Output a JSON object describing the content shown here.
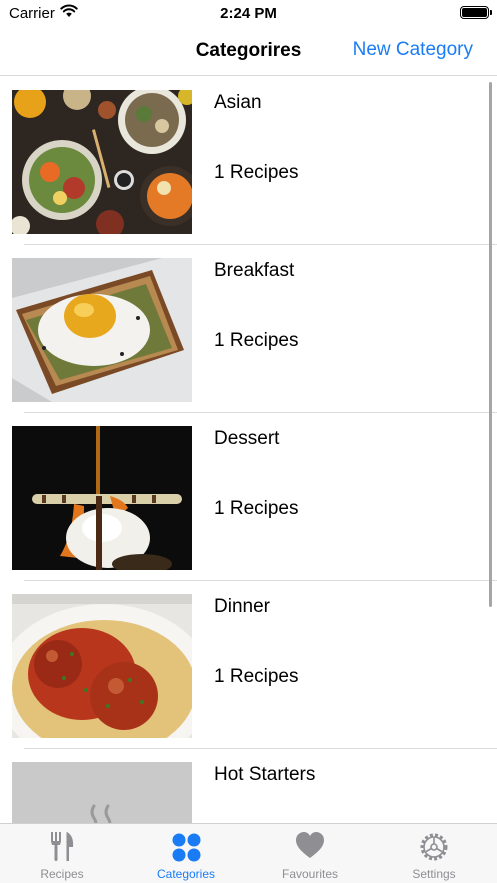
{
  "status_bar": {
    "carrier": "Carrier",
    "time": "2:24 PM"
  },
  "nav": {
    "title": "Categorires",
    "right_button": "New Category"
  },
  "colors": {
    "accent": "#1a7cf5",
    "inactive": "#8e8e93",
    "separator": "#dcdce0"
  },
  "categories": [
    {
      "name": "Asian",
      "count": "1 Recipes",
      "image": "asian-food-photo"
    },
    {
      "name": "Breakfast",
      "count": "1 Recipes",
      "image": "egg-toast-photo"
    },
    {
      "name": "Dessert",
      "count": "1 Recipes",
      "image": "ice-cream-dessert-photo"
    },
    {
      "name": "Dinner",
      "count": "1 Recipes",
      "image": "meatball-pasta-photo"
    },
    {
      "name": "Hot Starters",
      "count": "",
      "image": "placeholder-steam-icon"
    }
  ],
  "tabs": [
    {
      "label": "Recipes",
      "icon": "fork-knife-icon",
      "active": false
    },
    {
      "label": "Categories",
      "icon": "grid-dots-icon",
      "active": true
    },
    {
      "label": "Favourites",
      "icon": "heart-icon",
      "active": false
    },
    {
      "label": "Settings",
      "icon": "gear-icon",
      "active": false
    }
  ]
}
